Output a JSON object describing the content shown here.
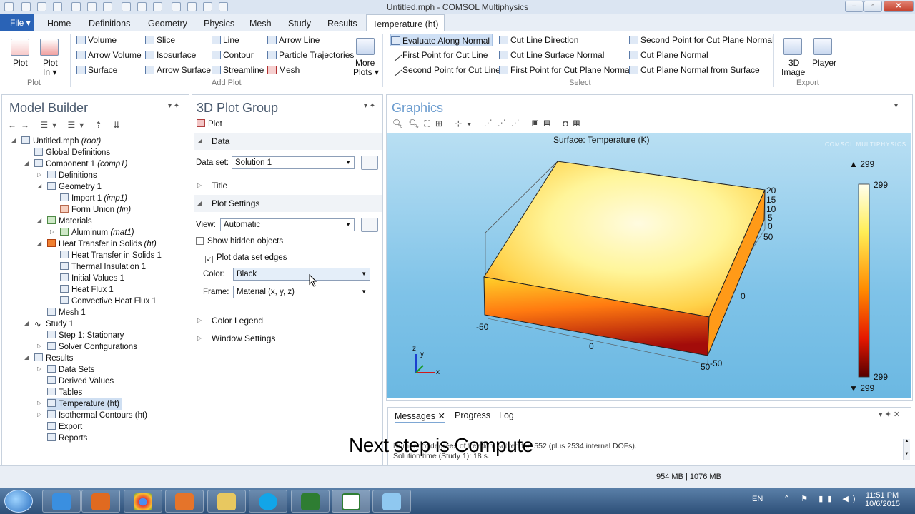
{
  "window": {
    "title": "Untitled.mph - COMSOL Multiphysics",
    "min": "–",
    "max": "▫",
    "close": "✕"
  },
  "menu": {
    "file": "File ▾",
    "tabs": [
      "Home",
      "Definitions",
      "Geometry",
      "Physics",
      "Mesh",
      "Study",
      "Results",
      "Temperature (ht)"
    ]
  },
  "ribbon": {
    "plot": "Plot",
    "plot_in": "Plot",
    "plot_in2": "In ▾",
    "add_plot": [
      "Volume",
      "Arrow Volume",
      "Surface",
      "Slice",
      "Isosurface",
      "Arrow Surface",
      "Line",
      "Contour",
      "Streamline",
      "Arrow Line",
      "Particle Trajectories",
      "Mesh"
    ],
    "more_plots": "More",
    "more_plots2": "Plots ▾",
    "select": [
      "Evaluate Along Normal",
      "First Point for Cut Line",
      "Second Point for Cut Line",
      "Cut Line Direction",
      "Cut Line Surface Normal",
      "First Point for Cut Plane Normal",
      "Second Point for Cut Plane Normal",
      "Cut Plane Normal",
      "Cut Plane Normal from Surface"
    ],
    "image3d": "3D",
    "image3d2": "Image",
    "player": "Player",
    "groups": {
      "plot": "Plot",
      "add_plot": "Add Plot",
      "select": "Select",
      "export": "Export"
    }
  },
  "model_builder": {
    "title": "Model Builder",
    "tree": [
      {
        "label": "Untitled.mph",
        "tag": "(root)"
      },
      {
        "label": "Global Definitions",
        "tag": ""
      },
      {
        "label": "Component 1",
        "tag": "(comp1)"
      },
      {
        "label": "Definitions",
        "tag": ""
      },
      {
        "label": "Geometry 1",
        "tag": ""
      },
      {
        "label": "Import 1",
        "tag": "(imp1)"
      },
      {
        "label": "Form Union",
        "tag": "(fin)"
      },
      {
        "label": "Materials",
        "tag": ""
      },
      {
        "label": "Aluminum",
        "tag": "(mat1)"
      },
      {
        "label": "Heat Transfer in Solids",
        "tag": "(ht)"
      },
      {
        "label": "Heat Transfer in Solids 1",
        "tag": ""
      },
      {
        "label": "Thermal Insulation 1",
        "tag": ""
      },
      {
        "label": "Initial Values 1",
        "tag": ""
      },
      {
        "label": "Heat Flux 1",
        "tag": ""
      },
      {
        "label": "Convective Heat Flux 1",
        "tag": ""
      },
      {
        "label": "Mesh 1",
        "tag": ""
      },
      {
        "label": "Study 1",
        "tag": ""
      },
      {
        "label": "Step 1: Stationary",
        "tag": ""
      },
      {
        "label": "Solver Configurations",
        "tag": ""
      },
      {
        "label": "Results",
        "tag": ""
      },
      {
        "label": "Data Sets",
        "tag": ""
      },
      {
        "label": "Derived Values",
        "tag": ""
      },
      {
        "label": "Tables",
        "tag": ""
      },
      {
        "label": "Temperature (ht)",
        "tag": ""
      },
      {
        "label": "Isothermal Contours (ht)",
        "tag": ""
      },
      {
        "label": "Export",
        "tag": ""
      },
      {
        "label": "Reports",
        "tag": ""
      }
    ]
  },
  "settings": {
    "title": "3D Plot Group",
    "plot_btn": "Plot",
    "data": "Data",
    "dataset_label": "Data set:",
    "dataset": "Solution 1",
    "title_sec": "Title",
    "plot_settings": "Plot Settings",
    "view_label": "View:",
    "view": "Automatic",
    "show_hidden": "Show hidden objects",
    "plot_edges": "Plot data set edges",
    "color_label": "Color:",
    "color": "Black",
    "frame_label": "Frame:",
    "frame": "Material  (x, y, z)",
    "color_legend": "Color Legend",
    "window_settings": "Window Settings"
  },
  "graphics": {
    "title": "Graphics",
    "plot_title": "Surface: Temperature (K)",
    "watermark": "COMSOL MULTIPHYSICS",
    "legend_max": "▲ 299",
    "legend_min": "▼ 299",
    "legend_top": "299",
    "legend_bottom": "299",
    "axis_ticks": {
      "z": [
        "20",
        "15",
        "10",
        "5",
        "0"
      ],
      "y_right": "50",
      "y_mid": "0",
      "x_left": "-50",
      "x_mid": "0",
      "x_right": "50",
      "y_bottom": "-50"
    },
    "triad": {
      "x": "x",
      "y": "y",
      "z": "z"
    },
    "colors": {
      "hot": "#a8000a",
      "mid": "#ff8a00",
      "cool": "#ffffcc"
    }
  },
  "messages": {
    "tabs": [
      "Messages",
      "Progress",
      "Log"
    ],
    "line1": "Number of degrees of freedom solved for: 552 (plus 2534 internal DOFs).",
    "line2": "Solution time (Study 1): 18 s."
  },
  "caption": "Next step is Compute",
  "status": {
    "memory": "954 MB | 1076 MB"
  },
  "taskbar": {
    "lang": "EN",
    "time": "11:51 PM",
    "date": "10/6/2015"
  }
}
